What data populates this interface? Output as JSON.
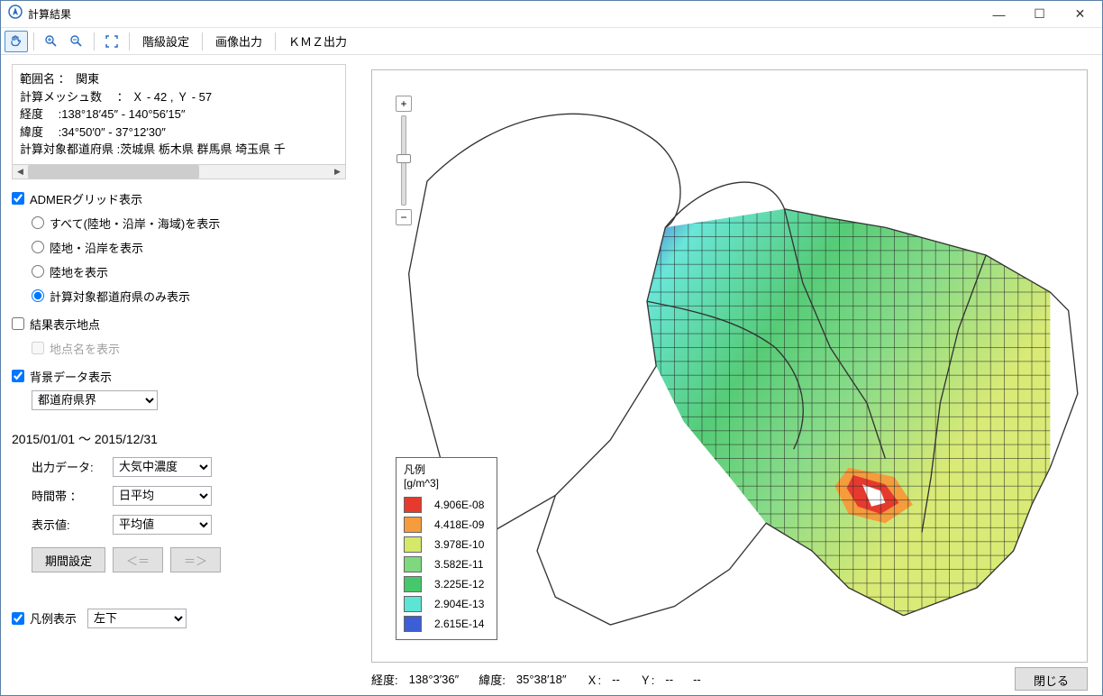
{
  "window": {
    "title": "計算結果"
  },
  "toolbar": {
    "class_settings": "階級設定",
    "image_output": "画像出力",
    "kmz_output": "ＫＭＺ出力"
  },
  "info": {
    "range_label": "範囲名 ：",
    "range_value": "　関東",
    "mesh_label": "計算メッシュ数　 ：",
    "mesh_value": "Ｘ - 42 , Ｙ - 57",
    "lon_label": "経度　 :",
    "lon_value": "138°18′45″ - 140°56′15″",
    "lat_label": "緯度　 :",
    "lat_value": "34°50′0″ - 37°12′30″",
    "pref_label": "計算対象都道府県 :",
    "pref_value": "茨城県 栃木県 群馬県 埼玉県 千"
  },
  "sidebar": {
    "admer_grid": "ADMERグリッド表示",
    "radio_all": "すべて(陸地・沿岸・海域)を表示",
    "radio_land_coast": "陸地・沿岸を表示",
    "radio_land": "陸地を表示",
    "radio_target": "計算対象都道府県のみ表示",
    "result_points": "結果表示地点",
    "point_names": "地点名を表示",
    "bg_data": "背景データ表示",
    "bg_select": "都道府県界",
    "period": "2015/01/01 ～ 2015/12/31",
    "output_label": "出力データ:",
    "output_value": "大気中濃度",
    "timeband_label": "時間帯 ：",
    "timeband_value": "日平均",
    "dispval_label": "表示値:",
    "dispval_value": "平均値",
    "period_btn": "期間設定",
    "prev_btn": "＜＝",
    "next_btn": "＝＞",
    "legend_show": "凡例表示",
    "legend_pos": "左下"
  },
  "legend": {
    "title_line1": "凡例",
    "title_line2": "[g/m^3]",
    "items": [
      {
        "color": "#e63a2e",
        "label": "4.906E-08"
      },
      {
        "color": "#f59c3c",
        "label": "4.418E-09"
      },
      {
        "color": "#d6e86a",
        "label": "3.978E-10"
      },
      {
        "color": "#7ed87e",
        "label": "3.582E-11"
      },
      {
        "color": "#47c76b",
        "label": "3.225E-12"
      },
      {
        "color": "#5ce4d4",
        "label": "2.904E-13"
      },
      {
        "color": "#3d5fd6",
        "label": "2.615E-14"
      }
    ]
  },
  "status": {
    "lon_label": "経度:",
    "lon_value": "138°3′36″",
    "lat_label": "緯度:",
    "lat_value": "35°38′18″",
    "x_label": "Ｘ:",
    "x_value": "--",
    "y_label": "Ｙ:",
    "y_value": "--",
    "trail": "--",
    "close": "閉じる"
  }
}
